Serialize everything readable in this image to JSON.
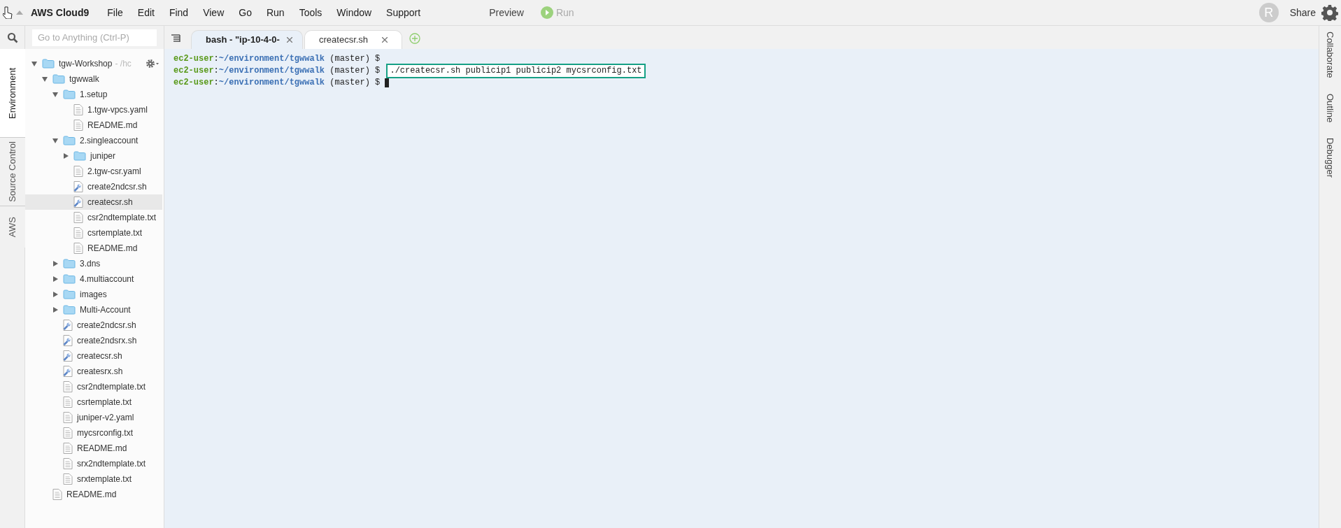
{
  "menu_bar": {
    "brand": "AWS Cloud9",
    "menus": [
      "File",
      "Edit",
      "Find",
      "View",
      "Go",
      "Run",
      "Tools",
      "Window",
      "Support"
    ],
    "preview": "Preview",
    "run": {
      "label": "Run",
      "disabled": true
    },
    "avatar": "R",
    "share": "Share"
  },
  "left_tabs": [
    {
      "label": "Environment",
      "selected": true
    },
    {
      "label": "Source Control",
      "selected": false
    },
    {
      "label": "AWS",
      "selected": false
    }
  ],
  "search": {
    "placeholder": "Go to Anything (Ctrl-P)"
  },
  "tree": [
    {
      "name": "tgw-Workshop",
      "path": "- /hc",
      "kind": "folder",
      "expanded": true,
      "selected": false,
      "children": [
        {
          "name": "tgwwalk",
          "kind": "folder",
          "expanded": true,
          "selected": false,
          "children": [
            {
              "name": "1.setup",
              "kind": "folder",
              "expanded": true,
              "selected": false,
              "children": [
                {
                  "name": "1.tgw-vpcs.yaml",
                  "kind": "file",
                  "selected": false
                },
                {
                  "name": "README.md",
                  "kind": "file",
                  "selected": false
                }
              ]
            },
            {
              "name": "2.singleaccount",
              "kind": "folder",
              "expanded": true,
              "selected": false,
              "children": [
                {
                  "name": "juniper",
                  "kind": "folder",
                  "expanded": false,
                  "selected": false
                },
                {
                  "name": "2.tgw-csr.yaml",
                  "kind": "file",
                  "selected": false
                },
                {
                  "name": "create2ndcsr.sh",
                  "kind": "script",
                  "selected": false
                },
                {
                  "name": "createcsr.sh",
                  "kind": "script",
                  "selected": true
                },
                {
                  "name": "csr2ndtemplate.txt",
                  "kind": "file",
                  "selected": false
                },
                {
                  "name": "csrtemplate.txt",
                  "kind": "file",
                  "selected": false
                },
                {
                  "name": "README.md",
                  "kind": "file",
                  "selected": false
                }
              ]
            },
            {
              "name": "3.dns",
              "kind": "folder",
              "expanded": false,
              "selected": false
            },
            {
              "name": "4.multiaccount",
              "kind": "folder",
              "expanded": false,
              "selected": false
            },
            {
              "name": "images",
              "kind": "folder",
              "expanded": false,
              "selected": false
            },
            {
              "name": "Multi-Account",
              "kind": "folder",
              "expanded": false,
              "selected": false
            },
            {
              "name": "create2ndcsr.sh",
              "kind": "script",
              "selected": false
            },
            {
              "name": "create2ndsrx.sh",
              "kind": "script",
              "selected": false
            },
            {
              "name": "createcsr.sh",
              "kind": "script",
              "selected": false
            },
            {
              "name": "createsrx.sh",
              "kind": "script",
              "selected": false
            },
            {
              "name": "csr2ndtemplate.txt",
              "kind": "file",
              "selected": false
            },
            {
              "name": "csrtemplate.txt",
              "kind": "file",
              "selected": false
            },
            {
              "name": "juniper-v2.yaml",
              "kind": "file",
              "selected": false
            },
            {
              "name": "mycsrconfig.txt",
              "kind": "file",
              "selected": false
            },
            {
              "name": "README.md",
              "kind": "file",
              "selected": false
            },
            {
              "name": "srx2ndtemplate.txt",
              "kind": "file",
              "selected": false
            },
            {
              "name": "srxtemplate.txt",
              "kind": "file",
              "selected": false
            }
          ]
        },
        {
          "name": "README.md",
          "kind": "file",
          "selected": false
        }
      ]
    }
  ],
  "editor_tabs": [
    {
      "label": "bash - \"ip-10-4-0-",
      "selected": true
    },
    {
      "label": "createcsr.sh",
      "selected": false
    }
  ],
  "terminal": [
    {
      "user": "ec2-user",
      "sep": ":",
      "path": "~/environment/tgwwalk",
      "branch": "(master) $",
      "cursor": false
    },
    {
      "user": "ec2-user",
      "sep": ":",
      "path": "~/environment/tgwwalk",
      "branch": "(master) $",
      "command": "./createcsr.sh publicip1 publicip2 mycsrconfig.txt",
      "highlighted": true,
      "cursor": false
    },
    {
      "user": "ec2-user",
      "sep": ":",
      "path": "~/environment/tgwwalk",
      "branch": "(master) $",
      "cursor": true
    }
  ],
  "right_tabs": [
    "Collaborate",
    "Outline",
    "Debugger"
  ]
}
